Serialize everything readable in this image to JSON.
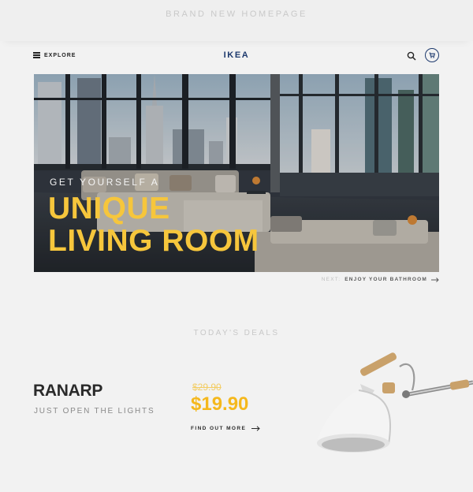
{
  "page": {
    "banner_title": "BRAND NEW HOMEPAGE"
  },
  "header": {
    "explore_label": "EXPLORE",
    "logo_text": "IKEA",
    "brand_color": "#1e3a6e"
  },
  "hero": {
    "subtitle": "GET YOURSELF A",
    "title_line1": "UNIQUE",
    "title_line2": "LIVING ROOM",
    "link_prefix": "NEXT:",
    "link_label": "ENJOY YOUR BATHROOM",
    "accent_color": "#f6c63c"
  },
  "deals": {
    "section_title": "TODAY'S DEALS",
    "product_name": "RANARP",
    "product_tagline": "JUST OPEN THE LIGHTS",
    "old_price": "$29.90",
    "price": "$19.90",
    "cta_label": "FIND OUT MORE",
    "price_color": "#f5b81c"
  },
  "icons": {
    "menu": "hamburger-icon",
    "search": "search-icon",
    "cart": "cart-icon",
    "arrow": "arrow-right-icon"
  }
}
